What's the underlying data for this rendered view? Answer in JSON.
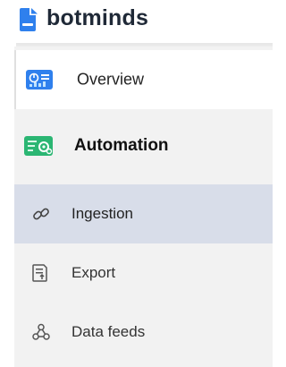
{
  "brand": {
    "name": "botminds",
    "logo_icon": "document-logo-icon",
    "color": "#2f80ed"
  },
  "sidebar": {
    "items": [
      {
        "label": "Overview",
        "icon": "dashboard-icon",
        "state": "normal"
      },
      {
        "label": "Automation",
        "icon": "automation-icon",
        "state": "section-header"
      },
      {
        "label": "Ingestion",
        "icon": "link-icon",
        "state": "selected"
      },
      {
        "label": "Export",
        "icon": "export-icon",
        "state": "normal"
      },
      {
        "label": "Data feeds",
        "icon": "data-feeds-icon",
        "state": "normal"
      }
    ]
  },
  "colors": {
    "selected_bg": "#d8dde9",
    "panel_bg": "#f2f2f2",
    "accent_blue": "#2f80ed",
    "accent_green": "#2bb673"
  }
}
